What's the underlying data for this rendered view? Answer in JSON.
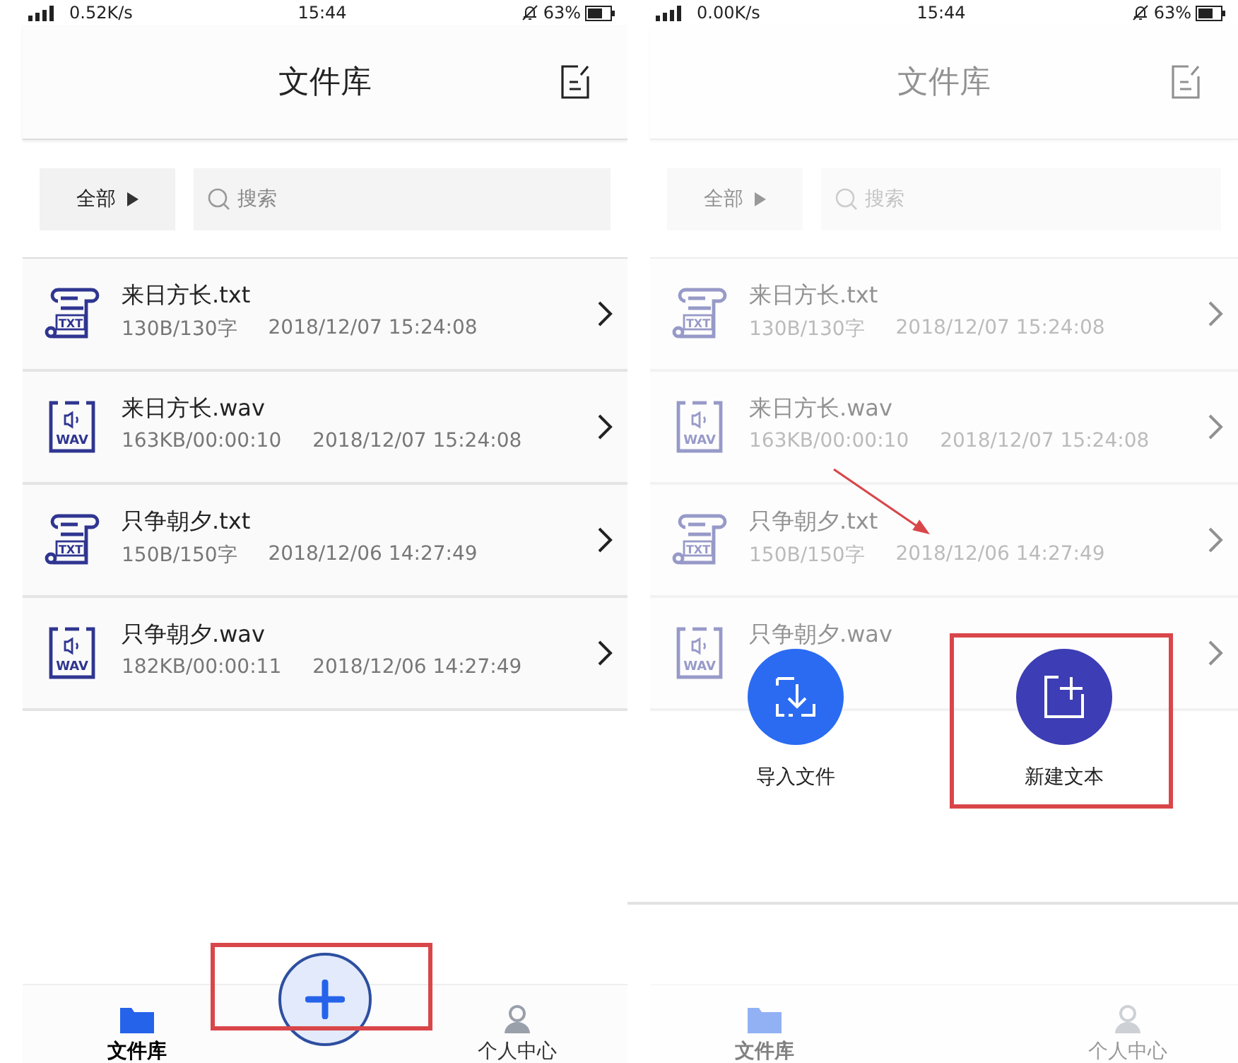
{
  "screens": [
    {
      "status": {
        "network": "0.52K/s",
        "time": "15:44",
        "battery": "63%"
      },
      "header": {
        "title": "文件库"
      },
      "filter": {
        "label": "全部",
        "placeholder": "搜索"
      },
      "files": [
        {
          "kind": "txt",
          "badge": "TXT",
          "name": "来日方长.txt",
          "size": "130B/130字",
          "date": "2018/12/07 15:24:08"
        },
        {
          "kind": "wav",
          "badge": "WAV",
          "name": "来日方长.wav",
          "size": "163KB/00:00:10",
          "date": "2018/12/07 15:24:08"
        },
        {
          "kind": "txt",
          "badge": "TXT",
          "name": "只争朝夕.txt",
          "size": "150B/150字",
          "date": "2018/12/06 14:27:49"
        },
        {
          "kind": "wav",
          "badge": "WAV",
          "name": "只争朝夕.wav",
          "size": "182KB/00:00:11",
          "date": "2018/12/06 14:27:49"
        }
      ],
      "tabs": [
        {
          "kind": "files",
          "label": "文件库",
          "selected": true
        },
        {
          "kind": "profile",
          "label": "个人中心",
          "selected": false
        }
      ],
      "add_button": {
        "highlighted": true
      }
    },
    {
      "status": {
        "network": "0.00K/s",
        "time": "15:44",
        "battery": "63%"
      },
      "header": {
        "title": "文件库"
      },
      "filter": {
        "label": "全部",
        "placeholder": "搜索"
      },
      "files": [
        {
          "kind": "txt",
          "badge": "TXT",
          "name": "来日方长.txt",
          "size": "130B/130字",
          "date": "2018/12/07 15:24:08"
        },
        {
          "kind": "wav",
          "badge": "WAV",
          "name": "来日方长.wav",
          "size": "163KB/00:00:10",
          "date": "2018/12/07 15:24:08"
        },
        {
          "kind": "txt",
          "badge": "TXT",
          "name": "只争朝夕.txt",
          "size": "150B/150字",
          "date": "2018/12/06 14:27:49"
        },
        {
          "kind": "wav",
          "badge": "WAV",
          "name": "只争朝夕.wav"
        }
      ],
      "tabs": [
        {
          "kind": "files",
          "label": "文件库",
          "selected": true
        },
        {
          "kind": "profile",
          "label": "个人中心",
          "selected": false
        }
      ],
      "sheet": {
        "actions": [
          {
            "kind": "import",
            "label": "导入文件",
            "color": "#2a6bf2",
            "highlighted": false
          },
          {
            "kind": "new-text",
            "label": "新建文本",
            "color": "#3d3db5",
            "highlighted": true
          }
        ]
      },
      "arrow": true
    }
  ]
}
